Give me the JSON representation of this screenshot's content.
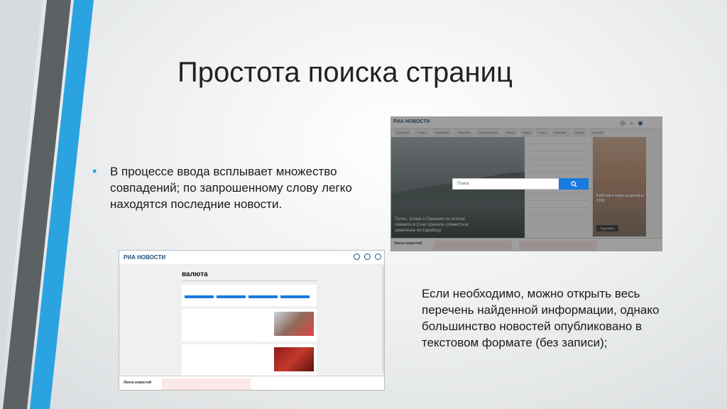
{
  "slide": {
    "title": "Простота поиска страниц",
    "bullet": "В процессе ввода всплывает множество совпадений; по запрошенному слову легко находятся последние новости.",
    "side_text": "Если необходимо, можно открыть весь перечень найденной информации, однако большинство новостей опубликовано в текстовом формате (без записи);"
  },
  "shot1": {
    "logo": "РИА НОВОСТИ",
    "nav": [
      "политика",
      "в мире",
      "экономика",
      "общество",
      "происшествия",
      "армия",
      "наука",
      "спорт",
      "культура",
      "туризм",
      "религия"
    ],
    "hero_caption": "Путин, Алиев и Пашинян по итогам саммита в Сочи приняли совместное заявление по Карабаху",
    "mid_items": [
      "",
      "",
      "",
      "",
      "",
      "",
      "",
      "",
      "",
      "",
      "",
      "",
      ""
    ],
    "ad_text": "Работай в мире моделей в СПб!",
    "ad_button": "Подробнее",
    "feed_label": "Лента новостей",
    "search_placeholder": "Поиск"
  },
  "shot2": {
    "logo": "РИА НОВОСТИ",
    "query": "валюта",
    "note": "",
    "filter_caption": "",
    "tags": [
      "",
      "",
      "",
      ""
    ],
    "cards": [
      {
        "title": "",
        "meta": ""
      },
      {
        "title": "",
        "meta": ""
      }
    ],
    "feed_label": "Лента новостей",
    "feed_items": [
      "",
      "",
      ""
    ]
  },
  "colors": {
    "accent_blue": "#2aa3e0",
    "stripe_dark": "#555a5c",
    "ria_blue": "#1a4d7a",
    "button_blue": "#1a7ae0"
  }
}
